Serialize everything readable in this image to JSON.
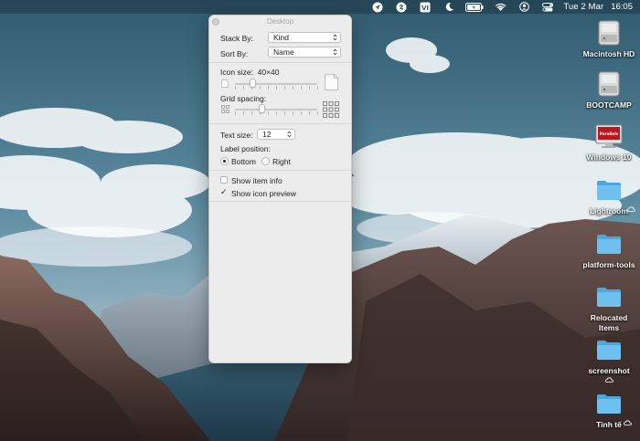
{
  "menubar": {
    "items": [
      {
        "name": "location-arrow-icon"
      },
      {
        "name": "shazam-icon"
      },
      {
        "name": "vietnamese-input-icon",
        "label": "VI"
      },
      {
        "name": "do-not-disturb-moon-icon"
      },
      {
        "name": "battery-icon"
      },
      {
        "name": "wifi-icon"
      },
      {
        "name": "user-account-icon"
      },
      {
        "name": "control-center-icon"
      }
    ],
    "date": "Tue 2 Mar",
    "time": "16:05"
  },
  "panel": {
    "title": "Desktop",
    "stack_by_label": "Stack By:",
    "stack_by_value": "Kind",
    "sort_by_label": "Sort By:",
    "sort_by_value": "Name",
    "icon_size_label": "Icon size:",
    "icon_size_value": "40×40",
    "icon_size_level": 0.22,
    "grid_spacing_label": "Grid spacing:",
    "grid_spacing_level": 0.33,
    "text_size_label": "Text size:",
    "text_size_value": "12",
    "label_position_label": "Label position:",
    "label_position_options": [
      "Bottom",
      "Right"
    ],
    "label_position_selected": "Bottom",
    "show_item_info_label": "Show item info",
    "show_item_info_checked": false,
    "show_icon_preview_label": "Show icon preview",
    "show_icon_preview_checked": true
  },
  "desktop_icons": [
    {
      "label": "Macintosh HD",
      "icon": "hard-drive-icon"
    },
    {
      "label": "BOOTCAMP",
      "icon": "hard-drive-icon"
    },
    {
      "label": "Windows 10",
      "icon": "parallels-vm-icon",
      "badge": "Parallels"
    },
    {
      "label": "Lightroom",
      "icon": "folder-icon",
      "cloud": true
    },
    {
      "label": "platform-tools",
      "icon": "folder-icon"
    },
    {
      "label": "Relocated Items",
      "icon": "folder-icon"
    },
    {
      "label": "screenshot",
      "icon": "folder-icon",
      "cloud": true
    },
    {
      "label": "Tinh tế",
      "icon": "folder-icon",
      "cloud": true
    }
  ],
  "colors": {
    "folder": "#5fb3e8",
    "sky": "#4a7186",
    "mountain": "#5a4a45"
  }
}
